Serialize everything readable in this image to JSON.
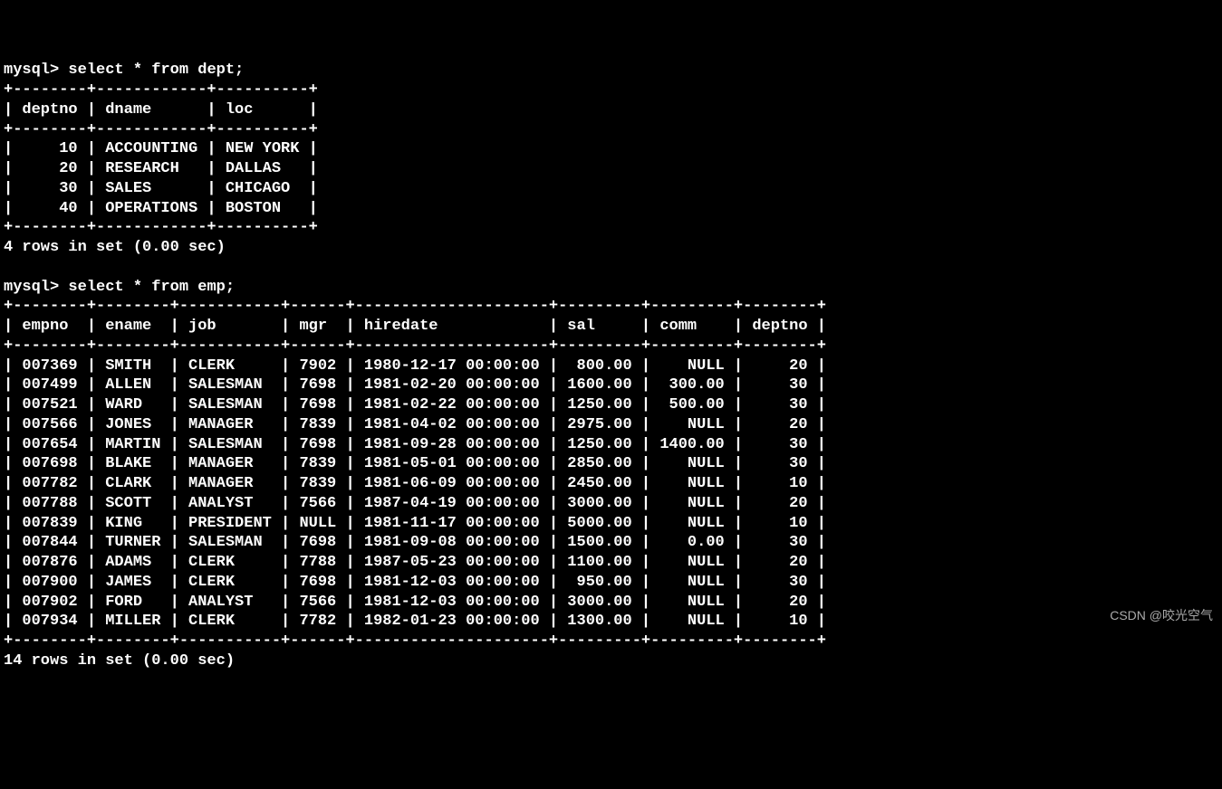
{
  "prompt": "mysql>",
  "query1": "select * from dept;",
  "query2": "select * from emp;",
  "dept_sep": "+--------+------------+----------+",
  "dept_header": "| deptno | dname      | loc      |",
  "dept_rows": [
    "|     10 | ACCOUNTING | NEW YORK |",
    "|     20 | RESEARCH   | DALLAS   |",
    "|     30 | SALES      | CHICAGO  |",
    "|     40 | OPERATIONS | BOSTON   |"
  ],
  "dept_footer": "4 rows in set (0.00 sec)",
  "emp_sep": "+--------+--------+-----------+------+---------------------+---------+---------+--------+",
  "emp_header": "| empno  | ename  | job       | mgr  | hiredate            | sal     | comm    | deptno |",
  "emp_rows": [
    "| 007369 | SMITH  | CLERK     | 7902 | 1980-12-17 00:00:00 |  800.00 |    NULL |     20 |",
    "| 007499 | ALLEN  | SALESMAN  | 7698 | 1981-02-20 00:00:00 | 1600.00 |  300.00 |     30 |",
    "| 007521 | WARD   | SALESMAN  | 7698 | 1981-02-22 00:00:00 | 1250.00 |  500.00 |     30 |",
    "| 007566 | JONES  | MANAGER   | 7839 | 1981-04-02 00:00:00 | 2975.00 |    NULL |     20 |",
    "| 007654 | MARTIN | SALESMAN  | 7698 | 1981-09-28 00:00:00 | 1250.00 | 1400.00 |     30 |",
    "| 007698 | BLAKE  | MANAGER   | 7839 | 1981-05-01 00:00:00 | 2850.00 |    NULL |     30 |",
    "| 007782 | CLARK  | MANAGER   | 7839 | 1981-06-09 00:00:00 | 2450.00 |    NULL |     10 |",
    "| 007788 | SCOTT  | ANALYST   | 7566 | 1987-04-19 00:00:00 | 3000.00 |    NULL |     20 |",
    "| 007839 | KING   | PRESIDENT | NULL | 1981-11-17 00:00:00 | 5000.00 |    NULL |     10 |",
    "| 007844 | TURNER | SALESMAN  | 7698 | 1981-09-08 00:00:00 | 1500.00 |    0.00 |     30 |",
    "| 007876 | ADAMS  | CLERK     | 7788 | 1987-05-23 00:00:00 | 1100.00 |    NULL |     20 |",
    "| 007900 | JAMES  | CLERK     | 7698 | 1981-12-03 00:00:00 |  950.00 |    NULL |     30 |",
    "| 007902 | FORD   | ANALYST   | 7566 | 1981-12-03 00:00:00 | 3000.00 |    NULL |     20 |",
    "| 007934 | MILLER | CLERK     | 7782 | 1982-01-23 00:00:00 | 1300.00 |    NULL |     10 |"
  ],
  "emp_footer": "14 rows in set (0.00 sec)",
  "watermark": "CSDN @咬光空气",
  "chart_data": {
    "type": "table",
    "tables": [
      {
        "name": "dept",
        "columns": [
          "deptno",
          "dname",
          "loc"
        ],
        "rows": [
          [
            10,
            "ACCOUNTING",
            "NEW YORK"
          ],
          [
            20,
            "RESEARCH",
            "DALLAS"
          ],
          [
            30,
            "SALES",
            "CHICAGO"
          ],
          [
            40,
            "OPERATIONS",
            "BOSTON"
          ]
        ]
      },
      {
        "name": "emp",
        "columns": [
          "empno",
          "ename",
          "job",
          "mgr",
          "hiredate",
          "sal",
          "comm",
          "deptno"
        ],
        "rows": [
          [
            "007369",
            "SMITH",
            "CLERK",
            7902,
            "1980-12-17 00:00:00",
            800.0,
            null,
            20
          ],
          [
            "007499",
            "ALLEN",
            "SALESMAN",
            7698,
            "1981-02-20 00:00:00",
            1600.0,
            300.0,
            30
          ],
          [
            "007521",
            "WARD",
            "SALESMAN",
            7698,
            "1981-02-22 00:00:00",
            1250.0,
            500.0,
            30
          ],
          [
            "007566",
            "JONES",
            "MANAGER",
            7839,
            "1981-04-02 00:00:00",
            2975.0,
            null,
            20
          ],
          [
            "007654",
            "MARTIN",
            "SALESMAN",
            7698,
            "1981-09-28 00:00:00",
            1250.0,
            1400.0,
            30
          ],
          [
            "007698",
            "BLAKE",
            "MANAGER",
            7839,
            "1981-05-01 00:00:00",
            2850.0,
            null,
            30
          ],
          [
            "007782",
            "CLARK",
            "MANAGER",
            7839,
            "1981-06-09 00:00:00",
            2450.0,
            null,
            10
          ],
          [
            "007788",
            "SCOTT",
            "ANALYST",
            7566,
            "1987-04-19 00:00:00",
            3000.0,
            null,
            20
          ],
          [
            "007839",
            "KING",
            "PRESIDENT",
            null,
            "1981-11-17 00:00:00",
            5000.0,
            null,
            10
          ],
          [
            "007844",
            "TURNER",
            "SALESMAN",
            7698,
            "1981-09-08 00:00:00",
            1500.0,
            0.0,
            30
          ],
          [
            "007876",
            "ADAMS",
            "CLERK",
            7788,
            "1987-05-23 00:00:00",
            1100.0,
            null,
            20
          ],
          [
            "007900",
            "JAMES",
            "CLERK",
            7698,
            "1981-12-03 00:00:00",
            950.0,
            null,
            30
          ],
          [
            "007902",
            "FORD",
            "ANALYST",
            7566,
            "1981-12-03 00:00:00",
            3000.0,
            null,
            20
          ],
          [
            "007934",
            "MILLER",
            "CLERK",
            7782,
            "1982-01-23 00:00:00",
            1300.0,
            null,
            10
          ]
        ]
      }
    ]
  }
}
